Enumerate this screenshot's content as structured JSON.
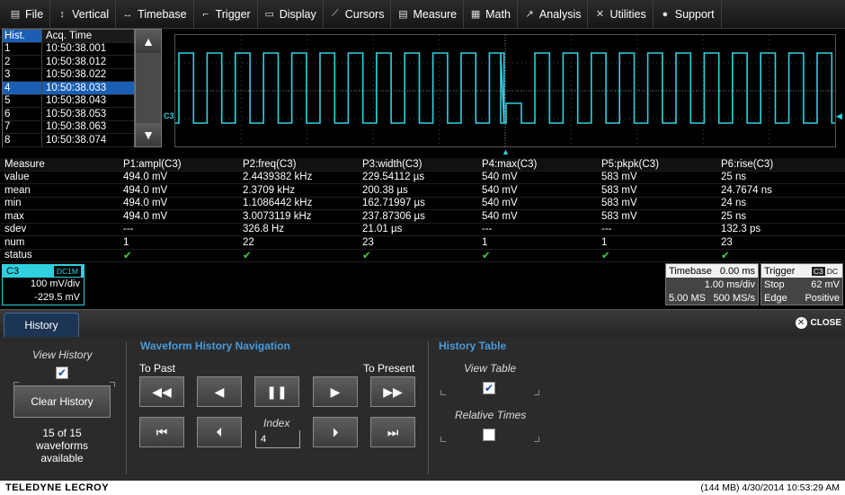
{
  "menu": {
    "items": [
      {
        "label": "File",
        "icon": "file-icon",
        "glyph": "▤"
      },
      {
        "label": "Vertical",
        "icon": "vertical-arrows-icon",
        "glyph": "↕"
      },
      {
        "label": "Timebase",
        "icon": "horizontal-arrows-icon",
        "glyph": "↔"
      },
      {
        "label": "Trigger",
        "icon": "trigger-icon",
        "glyph": "⌐"
      },
      {
        "label": "Display",
        "icon": "display-icon",
        "glyph": "▭"
      },
      {
        "label": "Cursors",
        "icon": "cursors-icon",
        "glyph": "⟋"
      },
      {
        "label": "Measure",
        "icon": "measure-icon",
        "glyph": "▤"
      },
      {
        "label": "Math",
        "icon": "math-icon",
        "glyph": "▦"
      },
      {
        "label": "Analysis",
        "icon": "analysis-icon",
        "glyph": "↗"
      },
      {
        "label": "Utilities",
        "icon": "utilities-icon",
        "glyph": "✕"
      },
      {
        "label": "Support",
        "icon": "support-icon",
        "glyph": "●"
      }
    ]
  },
  "history_table": {
    "headers": [
      "Hist.",
      "Acq. Time"
    ],
    "rows": [
      {
        "idx": "1",
        "time": "10:50:38.001"
      },
      {
        "idx": "2",
        "time": "10:50:38.012"
      },
      {
        "idx": "3",
        "time": "10:50:38.022"
      },
      {
        "idx": "4",
        "time": "10:50:38.033",
        "selected": true
      },
      {
        "idx": "5",
        "time": "10:50:38.043"
      },
      {
        "idx": "6",
        "time": "10:50:38.053"
      },
      {
        "idx": "7",
        "time": "10:50:38.063"
      },
      {
        "idx": "8",
        "time": "10:50:38.074"
      }
    ]
  },
  "scope": {
    "channel_label": "C3",
    "trace_color": "#30d0e0"
  },
  "measure": {
    "header_label": "Measure",
    "columns": [
      "P1:ampl(C3)",
      "P2:freq(C3)",
      "P3:width(C3)",
      "P4:max(C3)",
      "P5:pkpk(C3)",
      "P6:rise(C3)"
    ],
    "rows": [
      {
        "label": "value",
        "values": [
          "494.0 mV",
          "2.4439382 kHz",
          "229.54112 µs",
          "540 mV",
          "583 mV",
          "25 ns"
        ]
      },
      {
        "label": "mean",
        "values": [
          "494.0 mV",
          "2.3709 kHz",
          "200.38 µs",
          "540 mV",
          "583 mV",
          "24.7674 ns"
        ]
      },
      {
        "label": "min",
        "values": [
          "494.0 mV",
          "1.1086442 kHz",
          "162.71997 µs",
          "540 mV",
          "583 mV",
          "24 ns"
        ]
      },
      {
        "label": "max",
        "values": [
          "494.0 mV",
          "3.0073119 kHz",
          "237.87306 µs",
          "540 mV",
          "583 mV",
          "25 ns"
        ]
      },
      {
        "label": "sdev",
        "values": [
          "---",
          "326.8 Hz",
          "21.01 µs",
          "---",
          "---",
          "132.3 ps"
        ]
      },
      {
        "label": "num",
        "values": [
          "1",
          "22",
          "23",
          "1",
          "1",
          "23"
        ]
      },
      {
        "label": "status",
        "values": [
          "✔",
          "✔",
          "✔",
          "✔",
          "✔",
          "✔"
        ]
      }
    ]
  },
  "channel_box": {
    "name": "C3",
    "coupling": "DC1M",
    "vdiv": "100 mV/div",
    "offset": "-229.5 mV"
  },
  "timebase_box": {
    "title": "Timebase",
    "delay": "0.00 ms",
    "tdiv": "1.00 ms/div",
    "samples": "5.00 MS",
    "rate": "500 MS/s"
  },
  "trigger_box": {
    "title": "Trigger",
    "source": "C3",
    "coupling": "DC",
    "mode": "Stop",
    "level": "62 mV",
    "type": "Edge",
    "slope": "Positive"
  },
  "dialog": {
    "tab_label": "History",
    "close_label": "CLOSE",
    "view_history_label": "View History",
    "view_history_checked": "✔",
    "clear_history_label": "Clear History",
    "waveform_count": "15 of 15",
    "waveform_word": "waveforms",
    "waveform_available": "available",
    "nav_title": "Waveform History Navigation",
    "to_past": "To Past",
    "to_present": "To Present",
    "index_label": "Index",
    "index_value": "4",
    "table_title": "History Table",
    "view_table_label": "View Table",
    "view_table_checked": "✔",
    "relative_times_label": "Relative Times",
    "relative_times_checked": ""
  },
  "statusbar": {
    "brand": "TELEDYNE LECROY",
    "info": "(144 MB) 4/30/2014 10:53:29 AM"
  }
}
